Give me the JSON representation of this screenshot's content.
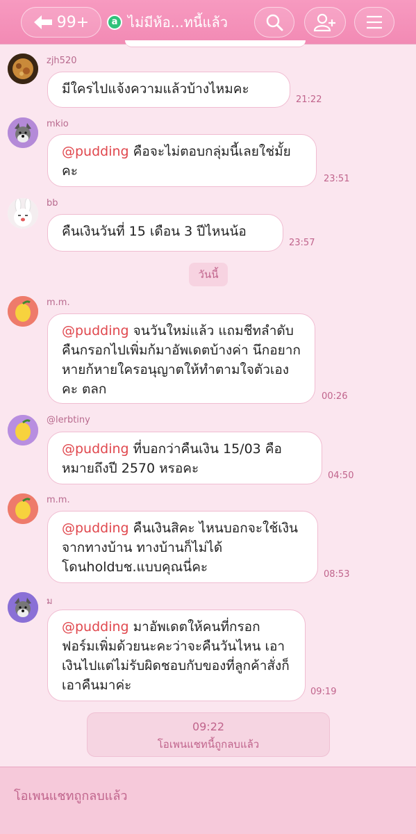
{
  "header": {
    "back_count": "99+",
    "group_icon": "group-badge-icon",
    "title": "ไม่มีห้อ...ทนี้แล้ว",
    "icons": [
      "arrow-left-icon",
      "search-icon",
      "add-friend-icon",
      "menu-icon"
    ]
  },
  "messages": [
    {
      "sender": "zjh520",
      "text": "มีใครไปแจ้งความแล้วบ้างไหมคะ",
      "time": "21:22"
    },
    {
      "sender": "mkio",
      "mention": "@pudding",
      "text": " คือจะไม่ตอบกลุ่มนี้เลยใช่มั้ยคะ",
      "time": "23:51"
    },
    {
      "sender": "bb",
      "text": "คืนเงินวันที่ 15 เดือน 3 ปีไหนน้อ",
      "time": "23:57"
    },
    {
      "sender": "m.m.",
      "mention": "@pudding",
      "text": " จนวันใหม่แล้ว แถมชีทลำดับคืนกรอกไปเพิ่มก้มาอัพเดตบ้างค่า นึกอยากหายก้หายใครอนุญาตให้ทำตามใจตัวเองคะ ตลก",
      "time": "00:26"
    },
    {
      "sender": "@lerbtiny",
      "mention": "@pudding",
      "text": " ที่บอกว่าคืนเงิน 15/03 คือหมายถึงปี 2570 หรอคะ",
      "time": "04:50"
    },
    {
      "sender": "m.m.",
      "mention": "@pudding",
      "text": " คืนเงินสิคะ ไหนบอกจะใช้เงินจากทางบ้าน ทางบ้านก็ไม่ได้โดนholdบช.แบบคุณนี่คะ",
      "time": "08:53"
    },
    {
      "sender": "ม",
      "mention": "@pudding",
      "text": " มาอัพเดตให้คนที่กรอกฟอร์มเพิ่มด้วยนะคะว่าจะคืนวันไหน เอาเงินไปแต่ไม่รับผิดชอบกับของที่ลูกค้าสั่งก็เอาคืนมาค่ะ",
      "time": "09:19"
    }
  ],
  "date_divider": "วันนี้",
  "system": {
    "time": "09:22",
    "text": "โอเพนแชทนี้ถูกลบแล้ว"
  },
  "footer": {
    "text": "โอเพนแชทถูกลบแล้ว"
  },
  "colors": {
    "header": "#f28ab4",
    "background": "#fbe6ef",
    "mention": "#e0474d",
    "accent": "#c0648c"
  }
}
